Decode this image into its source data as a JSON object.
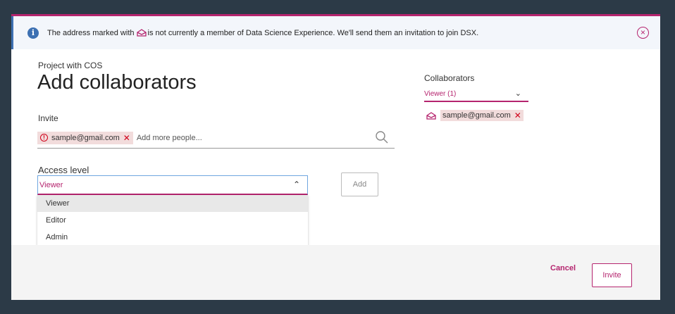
{
  "banner": {
    "text_before": "The address marked with",
    "text_after": "is not currently a member of Data Science Experience. We'll send them an invitation to join DSX.",
    "info_icon": "info-icon",
    "pending_icon": "pending-invite-icon",
    "close_icon": "close-circle-icon",
    "info_glyph": "i",
    "close_glyph": "×"
  },
  "header": {
    "project": "Project with COS",
    "title": "Add collaborators"
  },
  "invite": {
    "label": "Invite",
    "chip_email": "sample@gmail.com",
    "chip_remove": "✕",
    "warning_glyph": "!",
    "placeholder": "Add more people..."
  },
  "access": {
    "label": "Access level",
    "selected": "Viewer",
    "caret": "⌃",
    "options": [
      "Viewer",
      "Editor",
      "Admin"
    ]
  },
  "add_button": "Add",
  "collaborators": {
    "label": "Collaborators",
    "filter": "Viewer (1)",
    "caret": "⌄",
    "email": "sample@gmail.com",
    "remove": "✕"
  },
  "footer": {
    "cancel": "Cancel",
    "invite": "Invite"
  },
  "colors": {
    "accent": "#b5246e",
    "info": "#3d70b2",
    "error": "#d0021b",
    "backdrop": "#2c3a47"
  }
}
